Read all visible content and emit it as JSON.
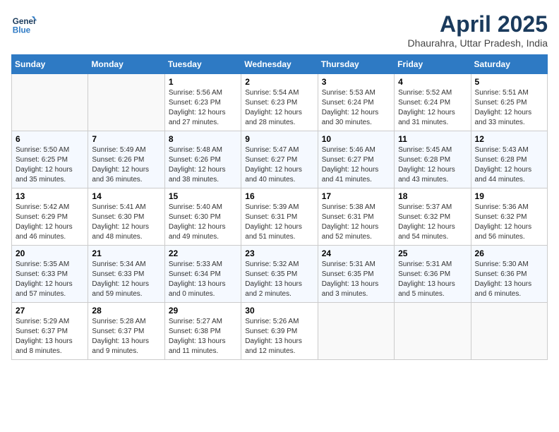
{
  "header": {
    "logo_text_general": "General",
    "logo_text_blue": "Blue",
    "title": "April 2025",
    "subtitle": "Dhaurahra, Uttar Pradesh, India"
  },
  "weekdays": [
    "Sunday",
    "Monday",
    "Tuesday",
    "Wednesday",
    "Thursday",
    "Friday",
    "Saturday"
  ],
  "weeks": [
    [
      {
        "day": "",
        "info": ""
      },
      {
        "day": "",
        "info": ""
      },
      {
        "day": "1",
        "info": "Sunrise: 5:56 AM\nSunset: 6:23 PM\nDaylight: 12 hours and 27 minutes."
      },
      {
        "day": "2",
        "info": "Sunrise: 5:54 AM\nSunset: 6:23 PM\nDaylight: 12 hours and 28 minutes."
      },
      {
        "day": "3",
        "info": "Sunrise: 5:53 AM\nSunset: 6:24 PM\nDaylight: 12 hours and 30 minutes."
      },
      {
        "day": "4",
        "info": "Sunrise: 5:52 AM\nSunset: 6:24 PM\nDaylight: 12 hours and 31 minutes."
      },
      {
        "day": "5",
        "info": "Sunrise: 5:51 AM\nSunset: 6:25 PM\nDaylight: 12 hours and 33 minutes."
      }
    ],
    [
      {
        "day": "6",
        "info": "Sunrise: 5:50 AM\nSunset: 6:25 PM\nDaylight: 12 hours and 35 minutes."
      },
      {
        "day": "7",
        "info": "Sunrise: 5:49 AM\nSunset: 6:26 PM\nDaylight: 12 hours and 36 minutes."
      },
      {
        "day": "8",
        "info": "Sunrise: 5:48 AM\nSunset: 6:26 PM\nDaylight: 12 hours and 38 minutes."
      },
      {
        "day": "9",
        "info": "Sunrise: 5:47 AM\nSunset: 6:27 PM\nDaylight: 12 hours and 40 minutes."
      },
      {
        "day": "10",
        "info": "Sunrise: 5:46 AM\nSunset: 6:27 PM\nDaylight: 12 hours and 41 minutes."
      },
      {
        "day": "11",
        "info": "Sunrise: 5:45 AM\nSunset: 6:28 PM\nDaylight: 12 hours and 43 minutes."
      },
      {
        "day": "12",
        "info": "Sunrise: 5:43 AM\nSunset: 6:28 PM\nDaylight: 12 hours and 44 minutes."
      }
    ],
    [
      {
        "day": "13",
        "info": "Sunrise: 5:42 AM\nSunset: 6:29 PM\nDaylight: 12 hours and 46 minutes."
      },
      {
        "day": "14",
        "info": "Sunrise: 5:41 AM\nSunset: 6:30 PM\nDaylight: 12 hours and 48 minutes."
      },
      {
        "day": "15",
        "info": "Sunrise: 5:40 AM\nSunset: 6:30 PM\nDaylight: 12 hours and 49 minutes."
      },
      {
        "day": "16",
        "info": "Sunrise: 5:39 AM\nSunset: 6:31 PM\nDaylight: 12 hours and 51 minutes."
      },
      {
        "day": "17",
        "info": "Sunrise: 5:38 AM\nSunset: 6:31 PM\nDaylight: 12 hours and 52 minutes."
      },
      {
        "day": "18",
        "info": "Sunrise: 5:37 AM\nSunset: 6:32 PM\nDaylight: 12 hours and 54 minutes."
      },
      {
        "day": "19",
        "info": "Sunrise: 5:36 AM\nSunset: 6:32 PM\nDaylight: 12 hours and 56 minutes."
      }
    ],
    [
      {
        "day": "20",
        "info": "Sunrise: 5:35 AM\nSunset: 6:33 PM\nDaylight: 12 hours and 57 minutes."
      },
      {
        "day": "21",
        "info": "Sunrise: 5:34 AM\nSunset: 6:33 PM\nDaylight: 12 hours and 59 minutes."
      },
      {
        "day": "22",
        "info": "Sunrise: 5:33 AM\nSunset: 6:34 PM\nDaylight: 13 hours and 0 minutes."
      },
      {
        "day": "23",
        "info": "Sunrise: 5:32 AM\nSunset: 6:35 PM\nDaylight: 13 hours and 2 minutes."
      },
      {
        "day": "24",
        "info": "Sunrise: 5:31 AM\nSunset: 6:35 PM\nDaylight: 13 hours and 3 minutes."
      },
      {
        "day": "25",
        "info": "Sunrise: 5:31 AM\nSunset: 6:36 PM\nDaylight: 13 hours and 5 minutes."
      },
      {
        "day": "26",
        "info": "Sunrise: 5:30 AM\nSunset: 6:36 PM\nDaylight: 13 hours and 6 minutes."
      }
    ],
    [
      {
        "day": "27",
        "info": "Sunrise: 5:29 AM\nSunset: 6:37 PM\nDaylight: 13 hours and 8 minutes."
      },
      {
        "day": "28",
        "info": "Sunrise: 5:28 AM\nSunset: 6:37 PM\nDaylight: 13 hours and 9 minutes."
      },
      {
        "day": "29",
        "info": "Sunrise: 5:27 AM\nSunset: 6:38 PM\nDaylight: 13 hours and 11 minutes."
      },
      {
        "day": "30",
        "info": "Sunrise: 5:26 AM\nSunset: 6:39 PM\nDaylight: 13 hours and 12 minutes."
      },
      {
        "day": "",
        "info": ""
      },
      {
        "day": "",
        "info": ""
      },
      {
        "day": "",
        "info": ""
      }
    ]
  ]
}
